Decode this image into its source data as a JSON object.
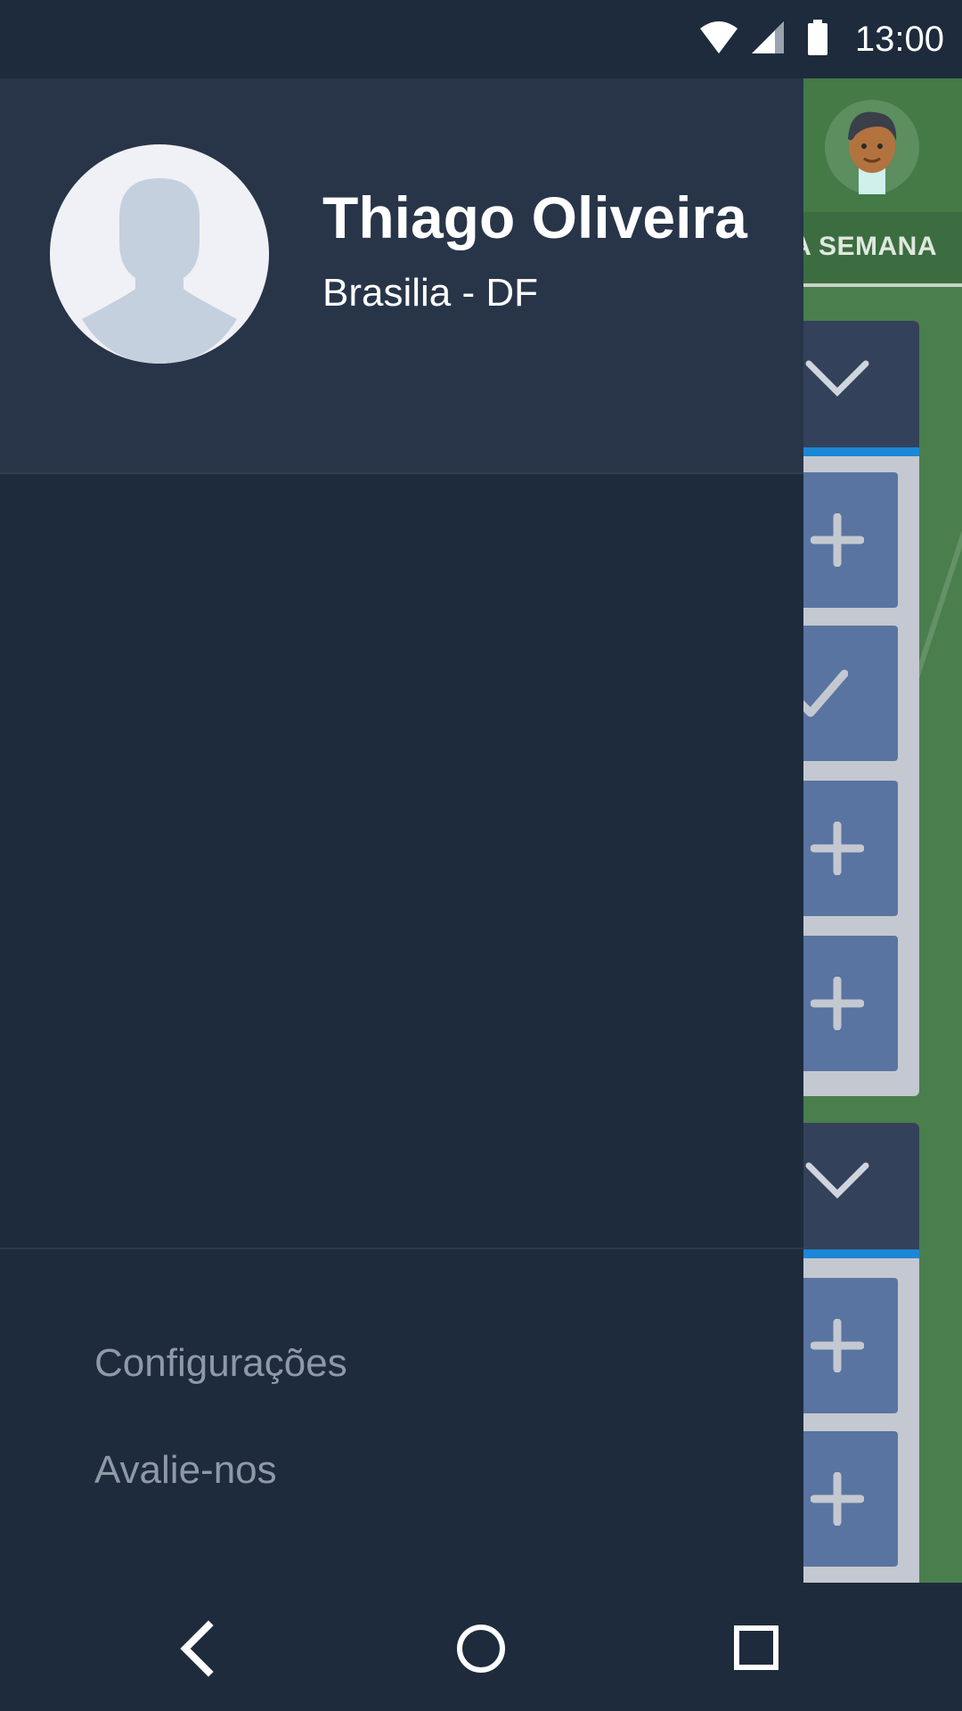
{
  "status_bar": {
    "time": "13:00",
    "icons": [
      "wifi-icon",
      "signal-icon",
      "battery-icon"
    ]
  },
  "background_app": {
    "tab_label": "DA SEMANA",
    "icons": [
      "avatar",
      "chevron-down-icon",
      "plus-icon",
      "check-icon"
    ]
  },
  "drawer": {
    "user_name": "Thiago Oliveira",
    "user_location": "Brasilia - DF",
    "menu": [
      {
        "label": "Configurações"
      },
      {
        "label": "Avalie-nos"
      }
    ]
  },
  "nav_bar": {
    "buttons": [
      "back-icon",
      "home-icon",
      "recents-icon"
    ]
  },
  "colors": {
    "drawer_bg": "#1e2b3c",
    "drawer_header_bg": "#283548",
    "app_green": "#4a7e4d",
    "slot_blue": "#5974a0",
    "accent_blue": "#1b87d6",
    "menu_text": "#8e99a8"
  }
}
